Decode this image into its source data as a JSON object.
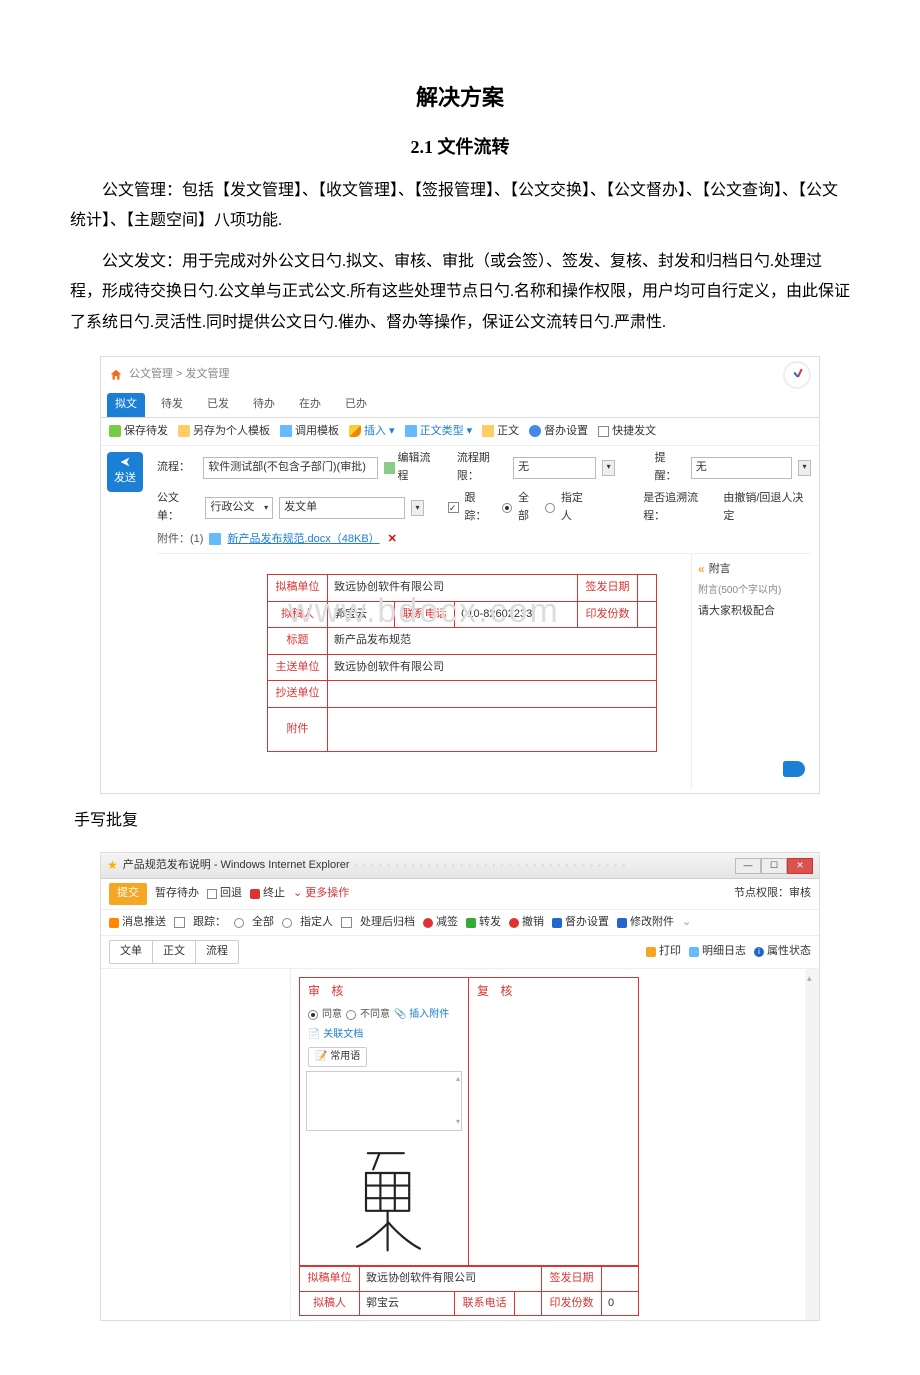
{
  "doc": {
    "title": "解决方案",
    "section": "2.1 文件流转",
    "p1": "公文管理：包括【发文管理】、【收文管理】、【签报管理】、【公文交换】、【公文督办】、【公文查询】、【公文统计】、【主题空间】八项功能.",
    "p2": "公文发文：用于完成对外公文日勺.拟文、审核、审批（或会签）、签发、复核、封发和归档日勺.处理过程，形成待交换日勺.公文单与正式公文.所有这些处理节点日勺.名称和操作权限，用户均可自行定义，由此保证了系统日勺.灵活性.同时提供公文日勺.催办、督办等操作，保证公文流转日勺.严肃性.",
    "sub": "手写批复"
  },
  "ss1": {
    "breadcrumb": "公文管理 > 发文管理",
    "tabs": [
      "拟文",
      "待发",
      "已发",
      "待办",
      "在办",
      "已办"
    ],
    "toolbar": {
      "save": "保存待发",
      "savetpl": "另存为个人模板",
      "loadtpl": "调用模板",
      "insert": "插入 ▾",
      "type": "正文类型 ▾",
      "body": "正文",
      "super": "督办设置",
      "quick": "快捷发文"
    },
    "send": "发送",
    "form": {
      "flow_l": "流程：",
      "flow_v": "软件测试部(不包含子部门)(审批)",
      "editflow": "编辑流程",
      "deadline_l": "流程期限：",
      "deadline_v": "无",
      "remind_l": "提醒：",
      "remind_v": "无",
      "unit_l": "公文单：",
      "unit_v": "行政公文",
      "unit2": "发文单",
      "track_l": "跟踪：",
      "track_all": "全部",
      "track_sel": "指定人",
      "retrace_l": "是否追溯流程：",
      "retrace_v": "由撤销/回退人决定",
      "att_l": "附件：(1)",
      "att_name": "新产品发布规范.docx（48KB）"
    },
    "table": {
      "org_l": "拟稿单位",
      "org_v": "致远协创软件有限公司",
      "signdate_l": "签发日期",
      "drafter_l": "拟稿人",
      "drafter_v": "郭宝云",
      "tel_l": "联系电话",
      "tel_v": "010-82602233",
      "copies_l": "印发份数",
      "title_l": "标题",
      "title_v": "新产品发布规范",
      "main_l": "主送单位",
      "main_v": "致远协创软件有限公司",
      "cc_l": "抄送单位",
      "attach_l": "附件"
    },
    "side": {
      "title": "附言",
      "limit": "附言(500个字以内)",
      "text": "请大家积极配合"
    },
    "watermark": "www.bdocx.com"
  },
  "ss2": {
    "ie_title": "产品规范发布说明 - Windows Internet Explorer",
    "node_perm": "节点权限：审核",
    "row_a": {
      "submit": "提交",
      "hold": "暂存待办",
      "back": "回退",
      "stop": "终止",
      "more": "更多操作"
    },
    "row_b": {
      "msg": "消息推送",
      "track": "跟踪：",
      "all": "全部",
      "sel": "指定人",
      "arch": "处理后归档",
      "sign": "减签",
      "fwd": "转发",
      "cancel": "撤销",
      "super": "督办设置",
      "modatt": "修改附件"
    },
    "row_c": {
      "seg": [
        "文单",
        "正文",
        "流程"
      ],
      "print": "打印",
      "log": "明细日志",
      "prop": "属性状态"
    },
    "review": {
      "t1": "审 核",
      "t2": "复 核",
      "agree": "同意",
      "disagree": "不同意",
      "ins": "插入附件",
      "rel": "关联文档",
      "phr": "常用语"
    },
    "table": {
      "org_l": "拟稿单位",
      "org_v": "致远协创软件有限公司",
      "signdate_l": "签发日期",
      "drafter_l": "拟稿人",
      "drafter_v": "郭宝云",
      "tel_l": "联系电话",
      "copies_l": "印发份数",
      "copies_v": "0"
    }
  }
}
